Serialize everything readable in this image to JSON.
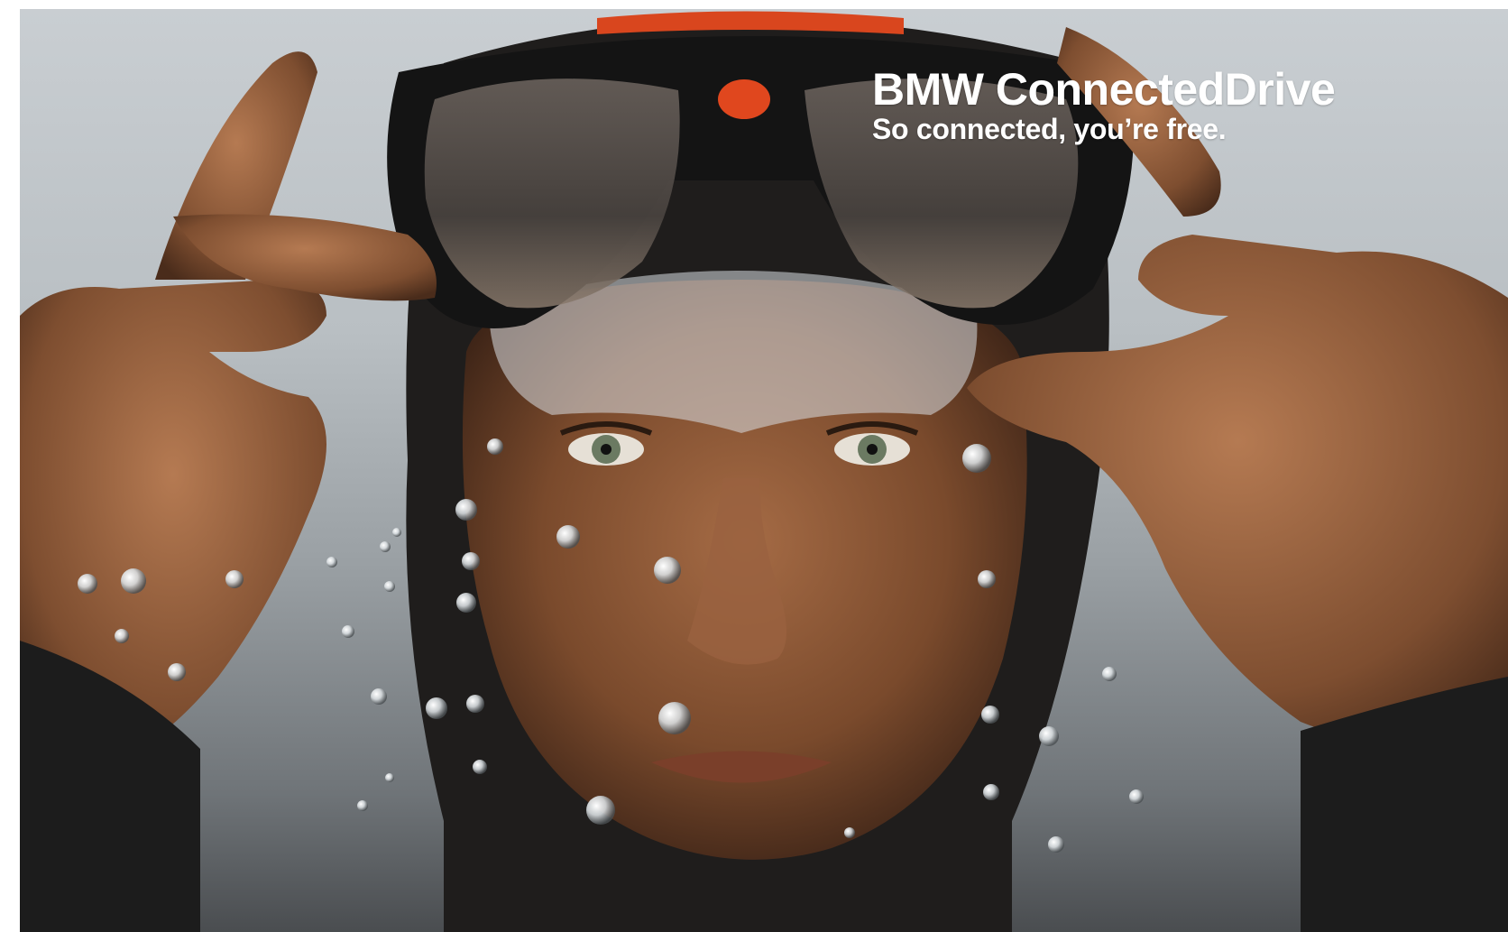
{
  "ad": {
    "brand_title": "BMW ConnectedDrive",
    "tagline": "So connected, you’re free."
  },
  "colors": {
    "background_gray": "#b9bfc3",
    "skin": "#8a5a3a",
    "mask_frame": "#1a1a1a",
    "mask_accent_orange": "#e0471e",
    "wetsuit": "#1c1c1c",
    "text": "#ffffff"
  }
}
